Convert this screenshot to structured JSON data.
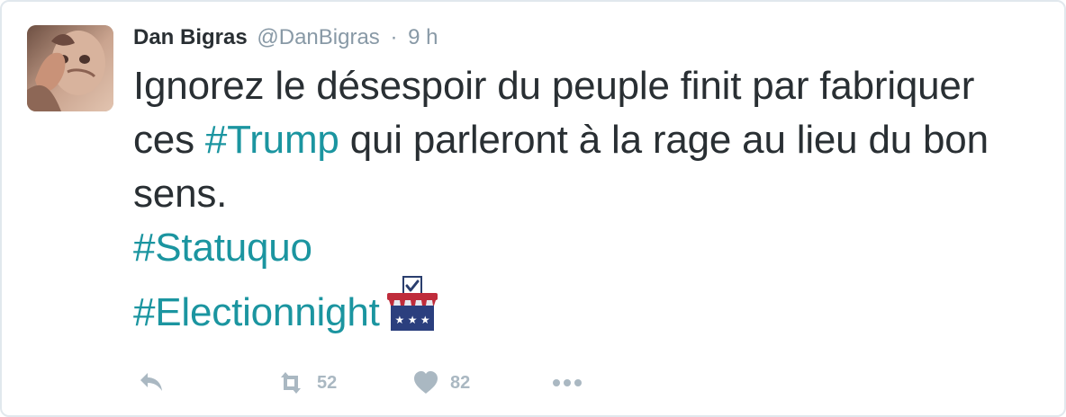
{
  "tweet": {
    "author_name": "Dan Bigras",
    "author_handle": "@DanBigras",
    "separator": "·",
    "time": "9 h",
    "text_part1": "Ignorez le désespoir du peuple finit par fabriquer ces",
    "hashtag_trump": "#Trump",
    "text_part2": "qui parleront à la rage au lieu du bon sens.",
    "hashtag_statuquo": "#Statuquo",
    "hashtag_electionnight": "#Electionnight"
  },
  "actions": {
    "retweet_count": "52",
    "like_count": "82"
  },
  "icons": {
    "avatar": "avatar",
    "reply": "reply-icon",
    "retweet": "retweet-icon",
    "like": "heart-icon",
    "more": "more-icon",
    "emoji": "ballot-box-icon"
  },
  "colors": {
    "hashtag": "#1b95a0",
    "muted": "#8899a6",
    "action": "#aab8c2",
    "text": "#292f33"
  }
}
